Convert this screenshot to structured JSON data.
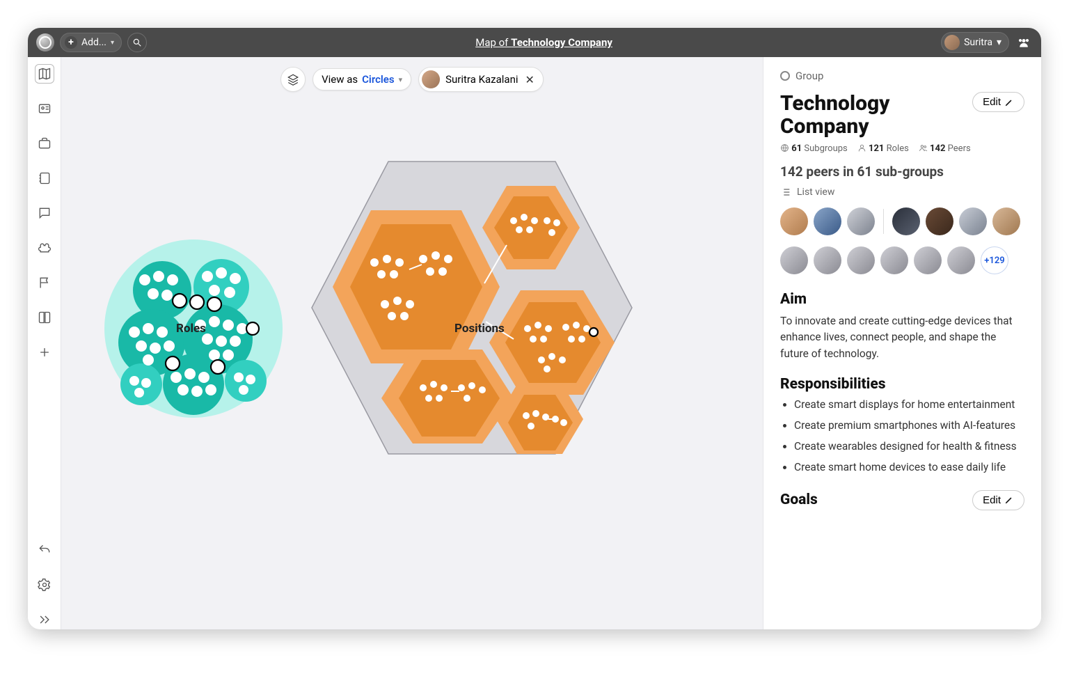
{
  "topbar": {
    "add_label": "Add...",
    "title_prefix": "Map of ",
    "title_name": "Technology Company",
    "user_name": "Suritra"
  },
  "controls": {
    "view_as_label": "View as",
    "view_mode": "Circles",
    "filter_person": "Suritra Kazalani"
  },
  "diagram": {
    "roles_label": "Roles",
    "positions_label": "Positions"
  },
  "panel": {
    "group_tag": "Group",
    "title": "Technology Company",
    "edit_label": "Edit",
    "stats": {
      "subgroups_n": "61",
      "subgroups_l": "Subgroups",
      "roles_n": "121",
      "roles_l": "Roles",
      "peers_n": "142",
      "peers_l": "Peers"
    },
    "subhead": "142 peers in 61 sub-groups",
    "listview_label": "List view",
    "more_count": "+129",
    "aim_title": "Aim",
    "aim_text": "To innovate and create cutting-edge devices that enhance lives, connect people, and shape the future of technology.",
    "resp_title": "Responsibilities",
    "responsibilities": [
      "Create smart displays for home entertainment",
      "Create premium smartphones with AI-features",
      "Create wearables designed for health & fitness",
      "Create smart home devices to ease daily life"
    ],
    "goals_title": "Goals"
  }
}
